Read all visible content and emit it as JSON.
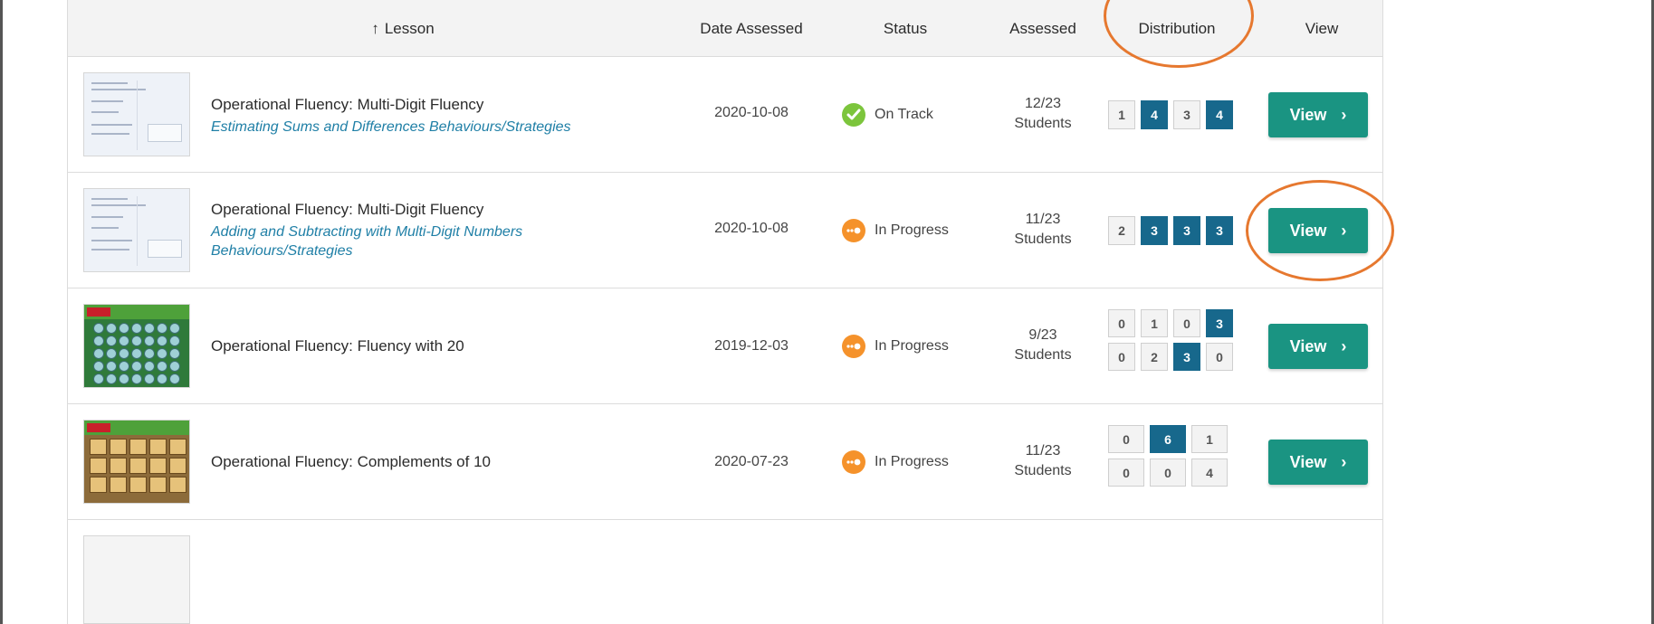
{
  "header": {
    "sort_arrow": "↑",
    "lesson": "Lesson",
    "date": "Date Assessed",
    "status": "Status",
    "assessed": "Assessed",
    "distribution": "Distribution",
    "view": "View"
  },
  "rows": [
    {
      "title": "Operational Fluency: Multi-Digit Fluency",
      "subtitle": "Estimating Sums and Differences Behaviours/Strategies",
      "date": "2020-10-08",
      "status": "On Track",
      "assessed_count": "12/23",
      "assessed_label": "Students",
      "distribution": [
        "1",
        "4",
        "3",
        "4"
      ],
      "view": "View"
    },
    {
      "title": "Operational Fluency: Multi-Digit Fluency",
      "subtitle": "Adding and Subtracting with Multi-Digit Numbers Behaviours/Strategies",
      "date": "2020-10-08",
      "status": "In Progress",
      "assessed_count": "11/23",
      "assessed_label": "Students",
      "distribution": [
        "2",
        "3",
        "3",
        "3"
      ],
      "view": "View"
    },
    {
      "title": "Operational Fluency: Fluency with 20",
      "date": "2019-12-03",
      "status": "In Progress",
      "assessed_count": "9/23",
      "assessed_label": "Students",
      "distribution": [
        "0",
        "1",
        "0",
        "3",
        "0",
        "2",
        "3",
        "0"
      ],
      "view": "View"
    },
    {
      "title": "Operational Fluency: Complements of 10",
      "date": "2020-07-23",
      "status": "In Progress",
      "assessed_count": "11/23",
      "assessed_label": "Students",
      "distribution": [
        "0",
        "6",
        "1",
        "0",
        "0",
        "4"
      ],
      "view": "View"
    }
  ],
  "icons": {
    "chevron": "›",
    "on_track": "check-icon",
    "in_progress": "progress-dots-icon"
  },
  "colors": {
    "view_button": "#1a9482",
    "highlight_cell": "#17688c",
    "on_track": "#7cc53c",
    "in_progress": "#f5922b",
    "annotation": "#e6782f",
    "subtitle_link": "#1f7fa6"
  }
}
